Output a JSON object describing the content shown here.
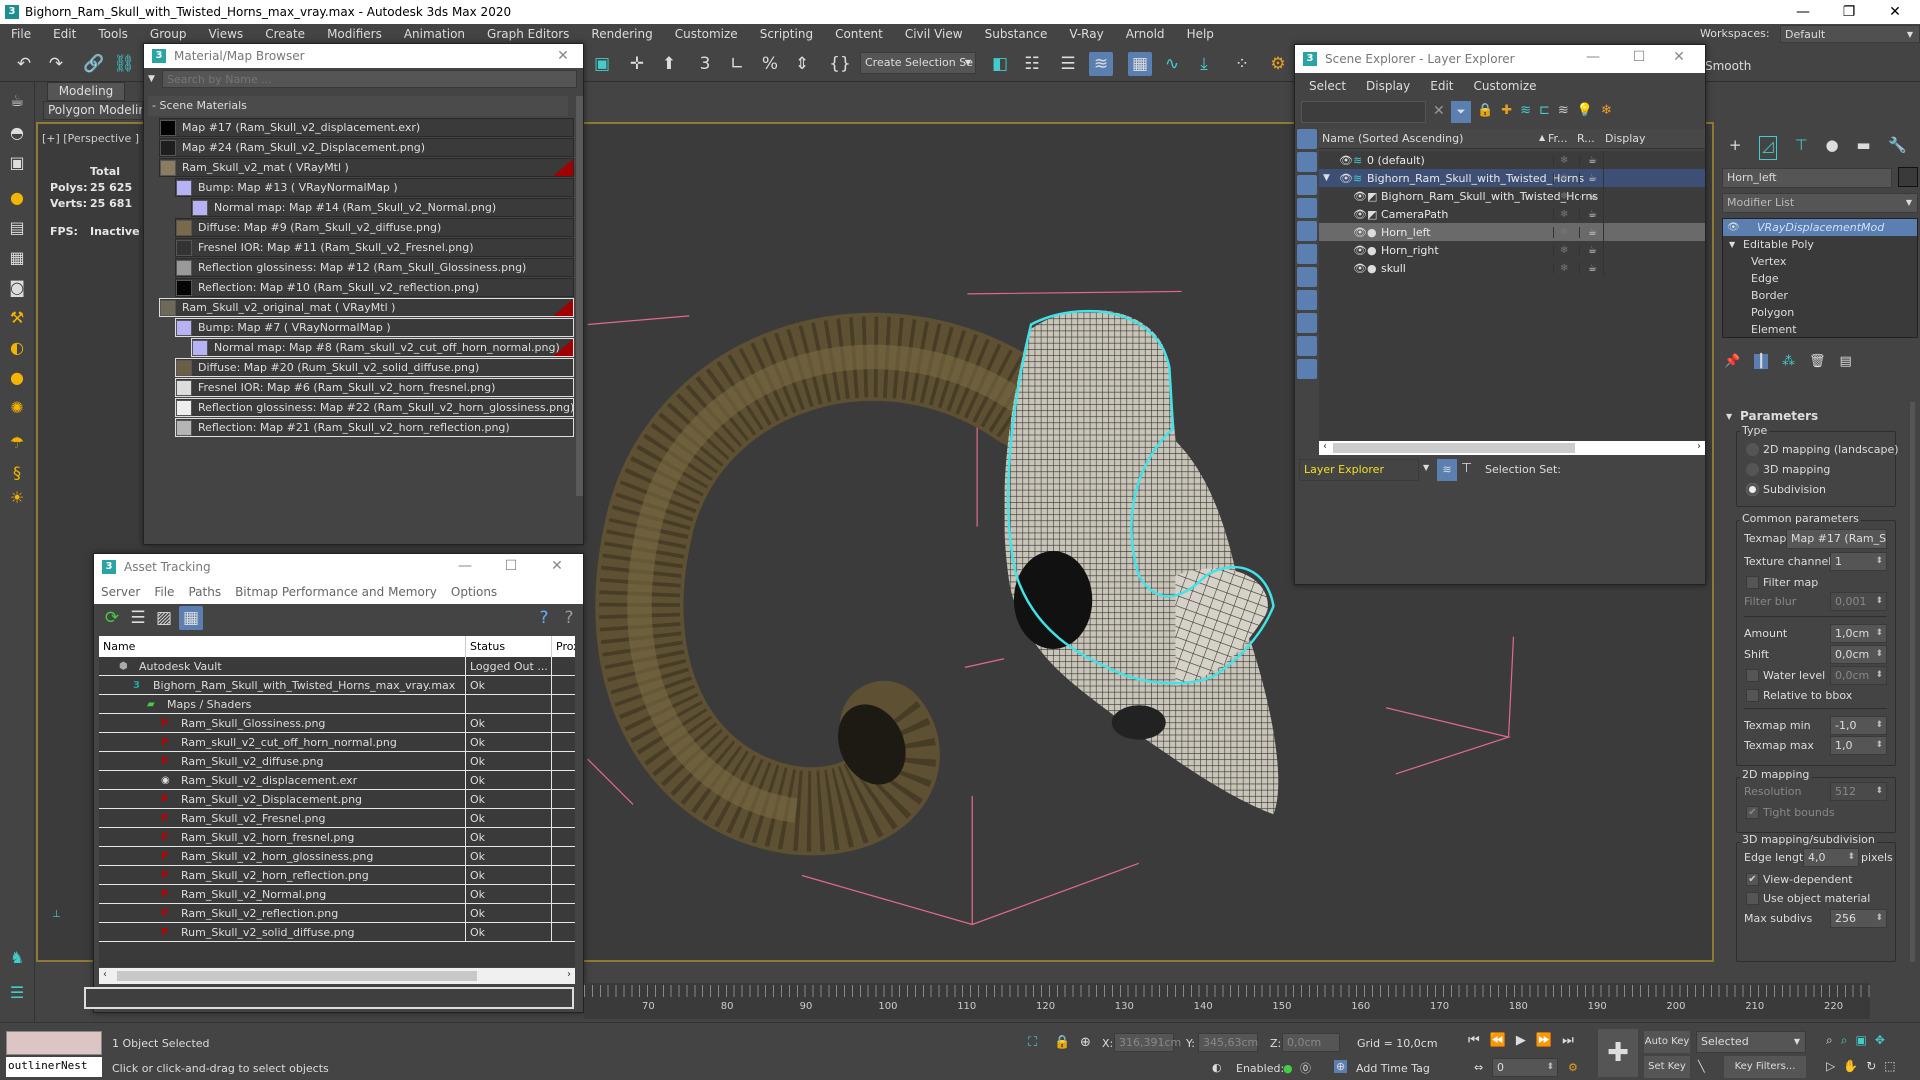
{
  "title_bar": {
    "title": "Bighorn_Ram_Skull_with_Twisted_Horns_max_vray.max - Autodesk 3ds Max 2020",
    "logo": "3",
    "minimize": "—",
    "restore": "❐",
    "close": "✕"
  },
  "menu": [
    "File",
    "Edit",
    "Tools",
    "Group",
    "Views",
    "Create",
    "Modifiers",
    "Animation",
    "Graph Editors",
    "Rendering",
    "Customize",
    "Scripting",
    "Content",
    "Civil View",
    "Substance",
    "V-Ray",
    "Arnold",
    "Help"
  ],
  "toolbar": {
    "selection_set": "Create Selection Se",
    "workspaces_label": "Workspaces:",
    "workspaces_value": "Default"
  },
  "ribbon": {
    "tab": "Modeling",
    "sub": "Polygon Modelin",
    "smooth": "Smooth"
  },
  "viewport": {
    "label": "[+] [Perspective ] [S",
    "stats": {
      "total": "Total",
      "polys_label": "Polys:",
      "polys": "25 625",
      "verts_label": "Verts:",
      "verts": "25 681",
      "fps_label": "FPS:",
      "fps": "Inactive"
    },
    "selection_color": "#3fe3e8",
    "bbox_color": "#e06a8a"
  },
  "material_browser": {
    "title": "Material/Map Browser",
    "logo": "3",
    "close": "✕",
    "search_placeholder": "Search by Name ...",
    "section": "- Scene Materials",
    "items": [
      {
        "label": "Map #17 (Ram_Skull_v2_displacement.exr)",
        "level": 0,
        "swatch": "#000000"
      },
      {
        "label": "Map #24 (Ram_Skull_v2_Displacement.png)",
        "level": 0,
        "swatch": "#1e1e1e"
      },
      {
        "label": "Ram_Skull_v2_mat  ( VRayMtl )",
        "level": 0,
        "swatch": "#8a7d62",
        "flag": true
      },
      {
        "label": "Bump: Map #13  ( VRayNormalMap )",
        "level": 1,
        "swatch": "#b7b2f5"
      },
      {
        "label": "Normal map: Map #14 (Ram_Skull_v2_Normal.png)",
        "level": 2,
        "swatch": "#b7b2f5"
      },
      {
        "label": "Diffuse: Map #9 (Ram_Skull_v2_diffuse.png)",
        "level": 1,
        "swatch": "#7a6a4a"
      },
      {
        "label": "Fresnel IOR: Map #11 (Ram_Skull_v2_Fresnel.png)",
        "level": 1,
        "swatch": "#333333"
      },
      {
        "label": "Reflection glossiness: Map #12 (Ram_Skull_Glossiness.png)",
        "level": 1,
        "swatch": "#9a9a9a"
      },
      {
        "label": "Reflection: Map #10 (Ram_Skull_v2_reflection.png)",
        "level": 1,
        "swatch": "#050505"
      },
      {
        "label": "Ram_Skull_v2_original_mat  ( VRayMtl )",
        "level": 0,
        "swatch": "#6e6a5a",
        "flag": true,
        "outlined": true
      },
      {
        "label": "Bump: Map #7  ( VRayNormalMap )",
        "level": 1,
        "swatch": "#b7b2f5",
        "outlined": true
      },
      {
        "label": "Normal map: Map #8 (Ram_skull_v2_cut_off_horn_normal.png)",
        "level": 2,
        "swatch": "#b7b2f5",
        "flag": true,
        "outlined": true
      },
      {
        "label": "Diffuse: Map #20 (Rum_Skull_v2_solid_diffuse.png)",
        "level": 1,
        "swatch": "#6a5e48",
        "outlined": true
      },
      {
        "label": "Fresnel IOR: Map #6 (Ram_Skull_v2_horn_fresnel.png)",
        "level": 1,
        "swatch": "#dddddd",
        "outlined": true
      },
      {
        "label": "Reflection glossiness: Map #22 (Ram_Skull_v2_horn_glossiness.png)",
        "level": 1,
        "swatch": "#eeeeee",
        "outlined": true
      },
      {
        "label": "Reflection: Map #21 (Ram_Skull_v2_horn_reflection.png)",
        "level": 1,
        "swatch": "#b5b5b5",
        "outlined": true
      }
    ]
  },
  "asset_tracking": {
    "title": "Asset Tracking",
    "logo": "3",
    "minimize": "—",
    "maximize": "☐",
    "close": "✕",
    "menu": [
      "Server",
      "File",
      "Paths",
      "Bitmap Performance and Memory",
      "Options"
    ],
    "columns": [
      "Name",
      "Status",
      "Proxy"
    ],
    "rows": [
      {
        "name": "Autodesk Vault",
        "status": "Logged Out ...",
        "level": 0,
        "icon": "vault-icon"
      },
      {
        "name": "Bighorn_Ram_Skull_with_Twisted_Horns_max_vray.max",
        "status": "Ok",
        "level": 1,
        "icon": "max-file-icon"
      },
      {
        "name": "Maps / Shaders",
        "status": "",
        "level": 2,
        "icon": "maps-folder-icon"
      },
      {
        "name": "Ram_Skull_Glossiness.png",
        "status": "Ok",
        "level": 3,
        "icon": "png-icon"
      },
      {
        "name": "Ram_skull_v2_cut_off_horn_normal.png",
        "status": "Ok",
        "level": 3,
        "icon": "png-icon"
      },
      {
        "name": "Ram_Skull_v2_diffuse.png",
        "status": "Ok",
        "level": 3,
        "icon": "png-icon"
      },
      {
        "name": "Ram_Skull_v2_displacement.exr",
        "status": "Ok",
        "level": 3,
        "icon": "exr-icon"
      },
      {
        "name": "Ram_Skull_v2_Displacement.png",
        "status": "Ok",
        "level": 3,
        "icon": "png-icon"
      },
      {
        "name": "Ram_Skull_v2_Fresnel.png",
        "status": "Ok",
        "level": 3,
        "icon": "png-icon"
      },
      {
        "name": "Ram_Skull_v2_horn_fresnel.png",
        "status": "Ok",
        "level": 3,
        "icon": "png-icon"
      },
      {
        "name": "Ram_Skull_v2_horn_glossiness.png",
        "status": "Ok",
        "level": 3,
        "icon": "png-icon"
      },
      {
        "name": "Ram_Skull_v2_horn_reflection.png",
        "status": "Ok",
        "level": 3,
        "icon": "png-icon"
      },
      {
        "name": "Ram_Skull_v2_Normal.png",
        "status": "Ok",
        "level": 3,
        "icon": "png-icon"
      },
      {
        "name": "Ram_Skull_v2_reflection.png",
        "status": "Ok",
        "level": 3,
        "icon": "png-icon"
      },
      {
        "name": "Rum_Skull_v2_solid_diffuse.png",
        "status": "Ok",
        "level": 3,
        "icon": "png-icon"
      }
    ]
  },
  "scene_explorer": {
    "title": "Scene Explorer - Layer Explorer",
    "logo": "3",
    "minimize": "—",
    "maximize": "☐",
    "close": "✕",
    "menu": [
      "Select",
      "Display",
      "Edit",
      "Customize"
    ],
    "columns": [
      "Name (Sorted Ascending)",
      "Fr...",
      "R...",
      "Display"
    ],
    "rows": [
      {
        "name": "0 (default)",
        "level": 0,
        "icon": "layer-icon"
      },
      {
        "name": "Bighorn_Ram_Skull_with_Twisted_Horns",
        "level": 0,
        "icon": "layer-icon",
        "expanded": true,
        "highlight": true
      },
      {
        "name": "Bighorn_Ram_Skull_with_Twisted_Horns",
        "level": 1,
        "icon": "group-icon"
      },
      {
        "name": "CameraPath",
        "level": 1,
        "icon": "shape-icon"
      },
      {
        "name": "Horn_left",
        "level": 1,
        "icon": "object-icon",
        "selected": true
      },
      {
        "name": "Horn_right",
        "level": 1,
        "icon": "object-icon"
      },
      {
        "name": "skull",
        "level": 1,
        "icon": "object-icon"
      }
    ],
    "footer": {
      "mode": "Layer Explorer",
      "selection_set": "Selection Set:"
    }
  },
  "command_panel": {
    "object_name": "Horn_left",
    "object_color": "#3a3a3a",
    "modifier_list": "Modifier List",
    "stack": [
      {
        "label": "VRayDisplacementMod",
        "selected": true,
        "level": 0
      },
      {
        "label": "Editable Poly",
        "level": 0,
        "expanded": true
      },
      {
        "label": "Vertex",
        "level": 1
      },
      {
        "label": "Edge",
        "level": 1
      },
      {
        "label": "Border",
        "level": 1
      },
      {
        "label": "Polygon",
        "level": 1
      },
      {
        "label": "Element",
        "level": 1
      }
    ],
    "params": {
      "title": "Parameters",
      "type_label": "Type",
      "type_options": [
        "2D mapping (landscape)",
        "3D mapping",
        "Subdivision"
      ],
      "type_selected": "Subdivision",
      "common": "Common parameters",
      "texmap_label": "Texmap",
      "texmap": "Map #17 (Ram_S...",
      "texture_channel_label": "Texture channel",
      "texture_channel": "1",
      "filter_map_label": "Filter map",
      "filter_map": false,
      "filter_blur_label": "Filter blur",
      "filter_blur": "0,001",
      "amount_label": "Amount",
      "amount": "1,0cm",
      "shift_label": "Shift",
      "shift": "0,0cm",
      "water_level_label": "Water level",
      "water_level": "0,0cm",
      "water_level_on": false,
      "relative_label": "Relative to bbox",
      "relative_on": false,
      "texmap_min_label": "Texmap min",
      "texmap_min": "-1,0",
      "texmap_max_label": "Texmap max",
      "texmap_max": "1,0",
      "map2d": "2D mapping",
      "resolution_label": "Resolution",
      "resolution": "512",
      "tight_label": "Tight bounds",
      "tight_on": true,
      "map3d": "3D mapping/subdivision",
      "edge_length_label": "Edge length",
      "edge_length": "4,0",
      "pixels": "pixels",
      "view_dep_label": "View-dependent",
      "view_dep_on": true,
      "use_obj_mat_label": "Use object material",
      "use_obj_mat_on": false,
      "max_subdivs_label": "Max subdivs",
      "max_subdivs": "256"
    }
  },
  "timeline": {
    "ticks": [
      "70",
      "80",
      "90",
      "100",
      "110",
      "120",
      "130",
      "140",
      "150",
      "160",
      "170",
      "180",
      "190",
      "200",
      "210",
      "220"
    ]
  },
  "status_bar": {
    "maxscript": "outlinerNest",
    "selected": "1 Object Selected",
    "prompt": "Click or click-and-drag to select objects",
    "x_label": "X:",
    "x": "316,391cm",
    "y_label": "Y:",
    "y": "345,63cm",
    "z_label": "Z:",
    "z": "0,0cm",
    "grid": "Grid = 10,0cm",
    "enabled": "Enabled:",
    "add_time_tag": "Add Time Tag",
    "auto_key": "Auto Key",
    "set_key": "Set Key",
    "key_mode": "Selected",
    "key_filters": "Key Filters...",
    "frame": "0"
  }
}
